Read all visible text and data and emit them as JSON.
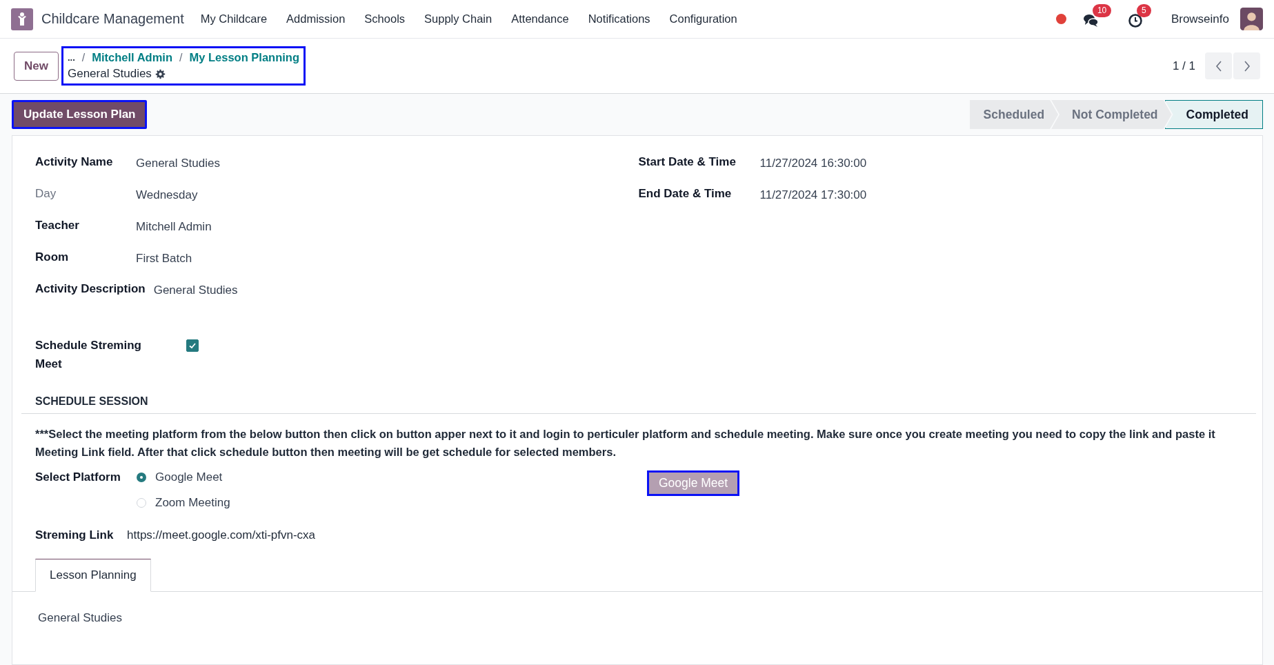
{
  "navbar": {
    "app_name": "Childcare Management",
    "menu": [
      "My Childcare",
      "Addmission",
      "Schools",
      "Supply Chain",
      "Attendance",
      "Notifications",
      "Configuration"
    ],
    "messages_badge": "10",
    "activities_badge": "5",
    "user": "Browseinfo"
  },
  "control_panel": {
    "new_button": "New",
    "breadcrumbs": [
      "...",
      "Mitchell Admin",
      "My Lesson Planning"
    ],
    "breadcrumb_separator": "/",
    "record_title": "General Studies",
    "highlighted": true,
    "pager": "1 / 1"
  },
  "header": {
    "action_button": {
      "label": "Update Lesson Plan",
      "highlighted": true
    },
    "stages": [
      {
        "label": "Scheduled",
        "selected": false
      },
      {
        "label": "Not Completed",
        "selected": false
      },
      {
        "label": "Completed",
        "selected": true
      }
    ]
  },
  "form": {
    "left_fields": [
      {
        "label": "Activity Name",
        "value": "General Studies",
        "bold": true
      },
      {
        "label": "Day",
        "value": "Wednesday",
        "bold": false
      },
      {
        "label": "Teacher",
        "value": "Mitchell Admin",
        "bold": true
      },
      {
        "label": "Room",
        "value": "First Batch",
        "bold": true
      },
      {
        "label": "Activity Description",
        "value": "General Studies",
        "bold": true
      }
    ],
    "right_fields": [
      {
        "label": "Start Date & Time",
        "value": "11/27/2024 16:30:00",
        "bold": true
      },
      {
        "label": "End Date & Time",
        "value": "11/27/2024 17:30:00",
        "bold": true
      }
    ],
    "schedule_meet": {
      "label": "Schedule Streming Meet",
      "checked": true
    },
    "section_title": "SCHEDULE SESSION",
    "note": "***Select the meeting platform from the below button then click on button apper next to it and login to perticuler platform and schedule meeting. Make sure once you create meeting you need to copy the link and paste it Meeting Link field. After that click schedule button then meeting will be get schedule for selected members.",
    "platform": {
      "label": "Select Platform",
      "options": [
        {
          "label": "Google Meet",
          "selected": true
        },
        {
          "label": "Zoom Meeting",
          "selected": false
        }
      ]
    },
    "platform_button": {
      "label": "Google Meet",
      "highlighted": true
    },
    "link": {
      "label": "Streming Link",
      "value": "https://meet.google.com/xti-pfvn-cxa"
    },
    "tabs": [
      {
        "label": "Lesson Planning",
        "selected": true
      }
    ],
    "tab_content": "General Studies"
  }
}
